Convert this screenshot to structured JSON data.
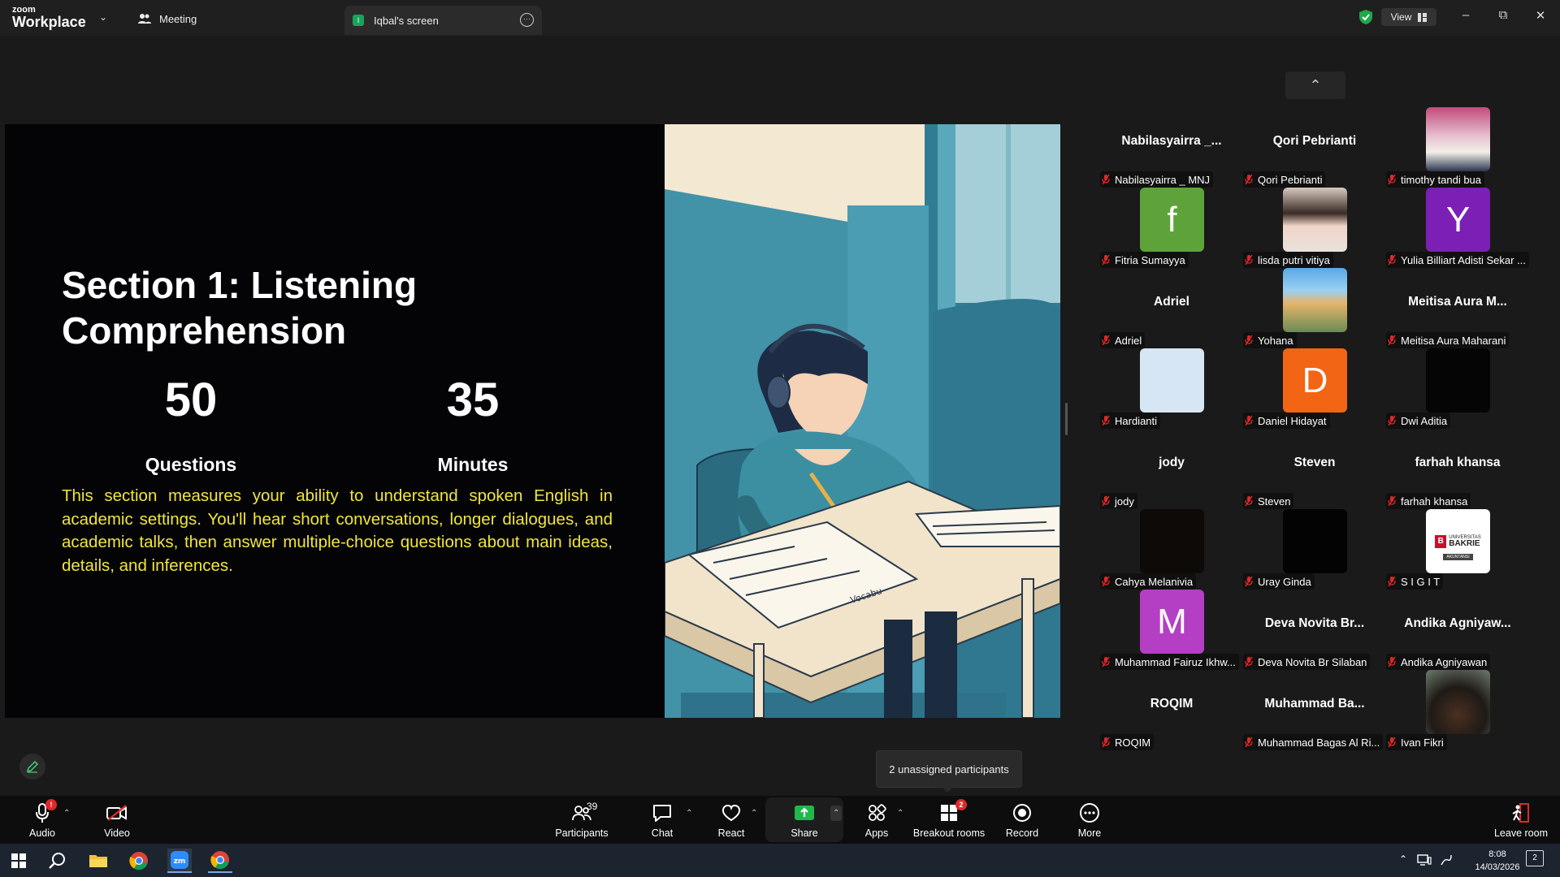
{
  "titlebar": {
    "logo_top": "zoom",
    "logo_bottom": "Workplace",
    "meeting_tab": "Meeting",
    "screen_tab_badge": "I",
    "screen_tab": "Iqbal's screen",
    "view_label": "View"
  },
  "slide": {
    "title": "Section 1: Listening Comprehension",
    "stat1_value": "50",
    "stat1_label": "Questions",
    "stat2_value": "35",
    "stat2_label": "Minutes",
    "description": "This section measures your ability to understand spoken English in academic settings. You'll hear short conversations, longer dialogues, and academic talks, then answer multiple-choice questions about main ideas, details, and inferences.",
    "illustration_text": "Vocabu"
  },
  "participants": [
    {
      "big": "Nabilasyairra _...",
      "label": "Nabilasyairra _ MNJ",
      "thumb": "none"
    },
    {
      "big": "Qori Pebrianti",
      "label": "Qori Pebrianti",
      "thumb": "none"
    },
    {
      "big": "",
      "label": "timothy tandi bua",
      "thumb": "photo-pink"
    },
    {
      "big": "",
      "label": "Fitria Sumayya",
      "thumb": "letter",
      "letter": "f",
      "color": "#5ea33a"
    },
    {
      "big": "",
      "label": "lisda putri vitiya",
      "thumb": "photo-girl"
    },
    {
      "big": "",
      "label": "Yulia Billiart Adisti Sekar ...",
      "thumb": "letter",
      "letter": "Y",
      "color": "#7b1fb5"
    },
    {
      "big": "Adriel",
      "label": "Adriel",
      "thumb": "none"
    },
    {
      "big": "",
      "label": "Yohana",
      "thumb": "photo-sky"
    },
    {
      "big": "Meitisa Aura M...",
      "label": "Meitisa Aura Maharani",
      "thumb": "none"
    },
    {
      "big": "",
      "label": "Hardianti",
      "thumb": "solid",
      "color": "#d6e6f4"
    },
    {
      "big": "",
      "label": "Daniel Hidayat",
      "thumb": "letter",
      "letter": "D",
      "color": "#f26514"
    },
    {
      "big": "",
      "label": "Dwi Aditia",
      "thumb": "solid",
      "color": "#050505"
    },
    {
      "big": "jody",
      "label": "jody",
      "thumb": "none"
    },
    {
      "big": "Steven",
      "label": "Steven",
      "thumb": "none"
    },
    {
      "big": "farhah khansa",
      "label": "farhah khansa",
      "thumb": "none"
    },
    {
      "big": "",
      "label": "Cahya Melanivia",
      "thumb": "solid",
      "color": "#0d0a08"
    },
    {
      "big": "",
      "label": "Uray Ginda",
      "thumb": "solid",
      "color": "#030303"
    },
    {
      "big": "",
      "label": "S I G I T",
      "thumb": "logo",
      "logo_line1": "UNIVERSITAS",
      "logo_line2": "BAKRIE",
      "logo_line3": "AKUNTANSI"
    },
    {
      "big": "",
      "label": "Muhammad Fairuz Ikhw...",
      "thumb": "letter",
      "letter": "M",
      "color": "#b43fc4"
    },
    {
      "big": "Deva Novita Br...",
      "label": "Deva Novita Br Silaban",
      "thumb": "none"
    },
    {
      "big": "Andika Agniyaw...",
      "label": "Andika Agniyawan",
      "thumb": "none"
    },
    {
      "big": "ROQIM",
      "label": "ROQIM",
      "thumb": "none"
    },
    {
      "big": "Muhammad Ba...",
      "label": "Muhammad Bagas Al Ri...",
      "thumb": "none"
    },
    {
      "big": "",
      "label": "Ivan Fikri",
      "thumb": "photo-dark"
    }
  ],
  "tooltip": "2 unassigned participants",
  "toolbar": {
    "audio": "Audio",
    "video": "Video",
    "participants": "Participants",
    "participants_count": "39",
    "chat": "Chat",
    "react": "React",
    "share": "Share",
    "apps": "Apps",
    "breakout": "Breakout rooms",
    "breakout_badge": "2",
    "record": "Record",
    "more": "More",
    "leave": "Leave room"
  },
  "taskbar": {
    "time": "8:08",
    "date": "14/03/2026",
    "notif_count": "2"
  },
  "colors": {
    "accent_green": "#1aa35b",
    "slide_text_yellow": "#f1e63a",
    "mic_off_red": "#e02828"
  }
}
